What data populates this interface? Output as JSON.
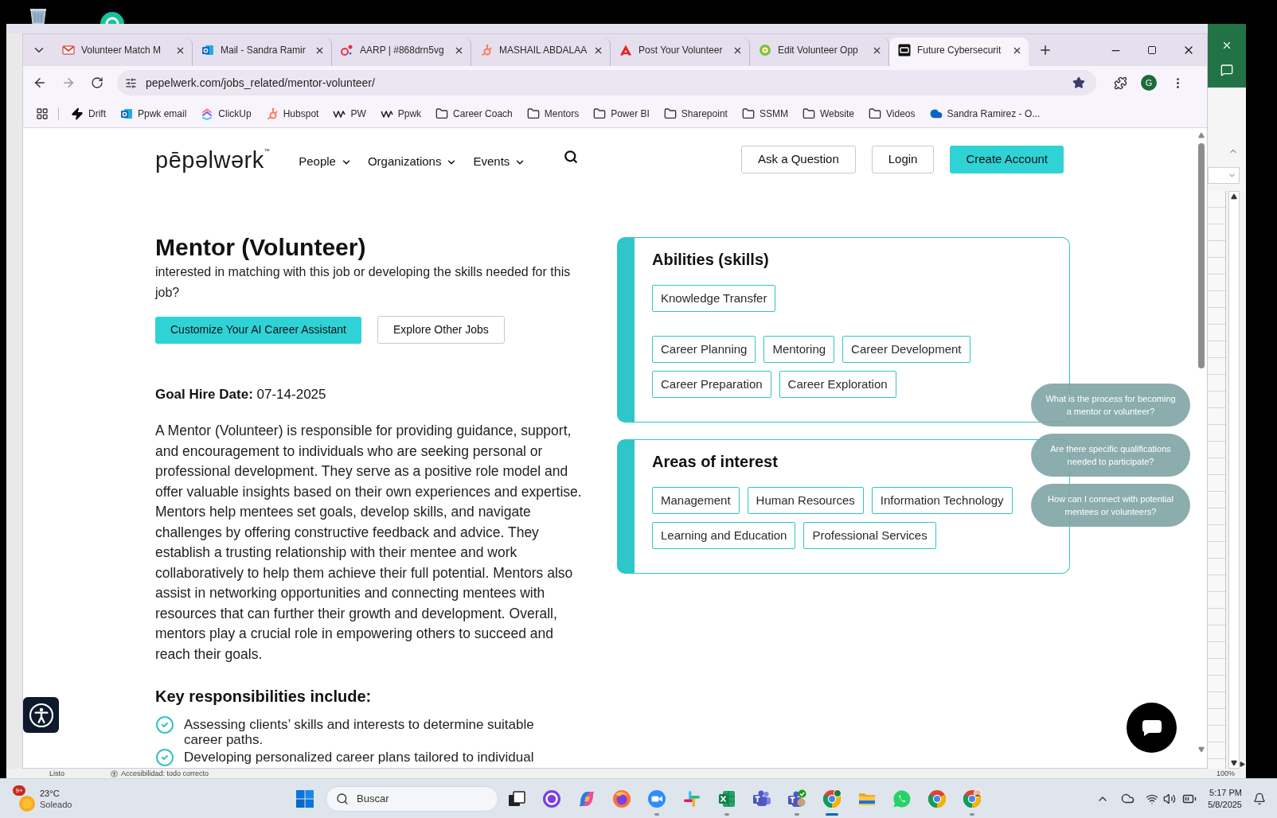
{
  "excel": {
    "status": "Listo",
    "accessibility": "Accesibilidad: todo correcto",
    "zoom": "100%"
  },
  "browser": {
    "tabs": [
      {
        "title": "Volunteer Match M",
        "selected": false
      },
      {
        "title": "Mail - Sandra Ramir",
        "selected": false
      },
      {
        "title": "AARP | #868drn5vg",
        "selected": false
      },
      {
        "title": "MASHAIL ABDALAA",
        "selected": false
      },
      {
        "title": "Post Your Volunteer",
        "selected": false
      },
      {
        "title": "Edit Volunteer Opp",
        "selected": false
      },
      {
        "title": "Future Cybersecurit",
        "selected": true
      }
    ],
    "url": "pepelwerk.com/jobs_related/mentor-volunteer/",
    "bookmarked": true,
    "profile_initial": "G",
    "bookmarks": [
      {
        "label": "Drift",
        "kind": "link"
      },
      {
        "label": "Ppwk email",
        "kind": "link"
      },
      {
        "label": "ClickUp",
        "kind": "link"
      },
      {
        "label": "Hubspot",
        "kind": "link"
      },
      {
        "label": "PW",
        "kind": "link"
      },
      {
        "label": "Ppwk",
        "kind": "link"
      },
      {
        "label": "Career Coach",
        "kind": "folder"
      },
      {
        "label": "Mentors",
        "kind": "folder"
      },
      {
        "label": "Power BI",
        "kind": "folder"
      },
      {
        "label": "Sharepoint",
        "kind": "folder"
      },
      {
        "label": "SSMM",
        "kind": "folder"
      },
      {
        "label": "Website",
        "kind": "folder"
      },
      {
        "label": "Videos",
        "kind": "folder"
      },
      {
        "label": "Sandra Ramirez - O...",
        "kind": "link"
      }
    ]
  },
  "page": {
    "logo": {
      "text": "pēpəlwərk",
      "mark": "™"
    },
    "nav": [
      "People",
      "Organizations",
      "Events"
    ],
    "header_buttons": [
      {
        "label": "Ask a Question",
        "kind": "outline"
      },
      {
        "label": "Login",
        "kind": "outline"
      },
      {
        "label": "Create Account",
        "kind": "primary"
      }
    ],
    "job": {
      "title": "Mentor (Volunteer)",
      "intro": "interested in matching with this job or developing the skills needed for this job?",
      "buttons": [
        {
          "label": "Customize Your AI Career Assistant",
          "kind": "primary"
        },
        {
          "label": "Explore Other Jobs",
          "kind": "outline"
        }
      ],
      "goal_date": "**Goal Hire Date:** 07-14-2025",
      "description": "A Mentor (Volunteer) is responsible for providing guidance, support, and encouragement to individuals who are seeking personal or professional development. They serve as a positive role model and offer valuable insights based on their own experiences and expertise. Mentors help mentees set goals, develop skills, and navigate challenges by offering constructive feedback and advice. They establish a trusting relationship with their mentee and work collaboratively to help them achieve their full potential. Mentors also assist in networking opportunities and connecting mentees with resources that can further their growth and development. Overall, mentors play a crucial role in empowering others to succeed and reach their goals.",
      "responsibilities_title": "Key responsibilities include:",
      "responsibilities": [
        "Assessing clients’ skills and interests to determine suitable career paths.",
        "Developing personalized career plans tailored to individual"
      ]
    },
    "abilities": {
      "title": "Abilities (skills)",
      "groups": [
        [
          "Knowledge Transfer"
        ],
        [
          "Career Planning",
          "Mentoring",
          "Career Development",
          "Career Preparation",
          "Career Exploration"
        ]
      ]
    },
    "interests": {
      "title": "Areas of interest",
      "groups": [
        [
          "Management",
          "Human Resources",
          "Information Technology",
          "Learning and Education",
          "Professional Services"
        ]
      ]
    },
    "chat_suggestions": [
      "What is the process for becoming a mentor or volunteer?",
      "Are there specific qualifications needed to participate?",
      "How can I connect with potential mentees or volunteers?"
    ]
  },
  "taskbar": {
    "weather": {
      "badge": "9+",
      "temperature": "23°C",
      "condition": "Soleado"
    },
    "search_label": "Buscar",
    "apps": [
      {
        "running": false,
        "selected": false
      },
      {
        "running": false,
        "selected": false
      },
      {
        "running": false,
        "selected": false
      },
      {
        "running": false,
        "selected": false
      },
      {
        "running": true,
        "selected": false
      },
      {
        "running": false,
        "selected": false
      },
      {
        "running": true,
        "selected": false
      },
      {
        "running": false,
        "selected": false
      },
      {
        "running": true,
        "selected": false
      },
      {
        "running": true,
        "selected": true
      },
      {
        "running": false,
        "selected": false
      },
      {
        "running": false,
        "selected": false
      },
      {
        "running": false,
        "selected": false
      },
      {
        "running": true,
        "selected": false
      }
    ],
    "clock": {
      "time": "5:17 PM",
      "date": "5/8/2025"
    }
  }
}
